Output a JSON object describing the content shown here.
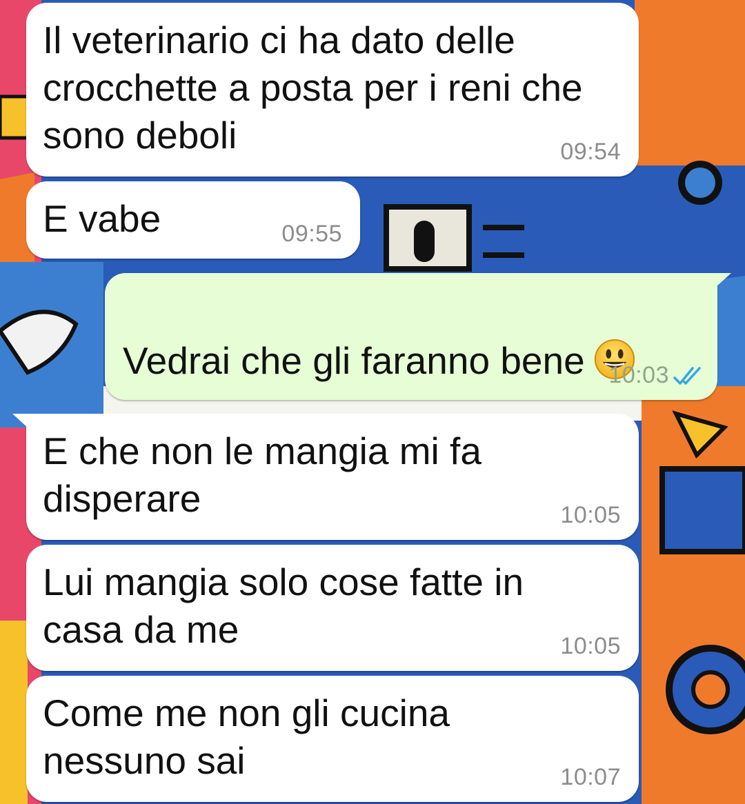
{
  "colors": {
    "incoming_bubble": "#ffffff",
    "outgoing_bubble": "#e6fdd5",
    "read_ticks": "#34a6e8",
    "timestamp": "#8c8c8c"
  },
  "messages": [
    {
      "direction": "incoming",
      "text": "Il veterinario ci ha dato delle\ncrocchette a posta per i reni che\nsono deboli",
      "time": "09:54"
    },
    {
      "direction": "incoming",
      "text": "E vabe",
      "time": "09:55"
    },
    {
      "direction": "outgoing",
      "text": "Vedrai che gli faranno bene",
      "emoji": "grinning-face-emoji",
      "time": "10:03",
      "status": "read-double-check-icon"
    },
    {
      "direction": "incoming",
      "text": "E che non le mangia mi fa\ndisperare",
      "time": "10:05"
    },
    {
      "direction": "incoming",
      "text": "Lui mangia solo cose fatte in\ncasa da me",
      "time": "10:05"
    },
    {
      "direction": "incoming",
      "text": "Come me non gli cucina\nnessuno sai",
      "time": "10:07"
    }
  ]
}
